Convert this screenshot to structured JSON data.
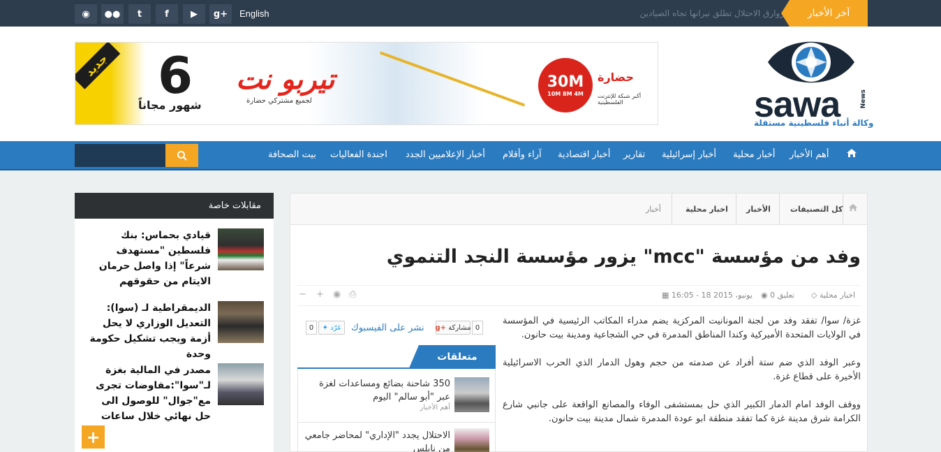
{
  "topbar": {
    "social": [
      {
        "icon": "rss-icon",
        "glyph": "◉"
      },
      {
        "icon": "flickr-icon",
        "glyph": "●●"
      },
      {
        "icon": "twitter-icon",
        "glyph": "t"
      },
      {
        "icon": "facebook-icon",
        "glyph": "f"
      },
      {
        "icon": "youtube-icon",
        "glyph": "▶"
      },
      {
        "icon": "google-plus-icon",
        "glyph": "g+"
      }
    ],
    "language_link": "English",
    "ticker_text": "زوارق الاحتلال تطلق نيرانها تجاه الصيادين",
    "latest_tab": "آخر الأخبار"
  },
  "header": {
    "logo_text": "sawa",
    "logo_news": "News",
    "logo_tagline": "وكالة أنباء فلسطينية مستقلة",
    "banner": {
      "new_label": "جديد",
      "big_number": "6",
      "months_text": "شهور مجاناً",
      "brand": "تيربو نت",
      "brand_sub": "لجميع مشتركي حضارة",
      "speed": "30M",
      "speed_sub": "10M 8M 4M",
      "isp": "حضارة",
      "isp_sub": "أكبر شبكة للإنترنت الفلسطينية"
    }
  },
  "nav": {
    "search_placeholder": "",
    "items": [
      "أهم الأخبار",
      "أخبار محلية",
      "أخبار إسرائيلية",
      "تقارير",
      "أخبار اقتصادية",
      "آراء وأقلام",
      "أخبار الإعلاميين الجدد",
      "اجندة الفعاليات",
      "بيت الصحافة"
    ]
  },
  "sidebar": {
    "title": "مقابلات خاصة",
    "items": [
      {
        "title": "قيادي بحماس: بنك فلسطين \"مستهدف شرعاً\" إذا واصل حرمان الايتام من حقوقهم"
      },
      {
        "title": "الديمقراطية لـ (سوا): التعديل الوزاري لا يحل أزمة ويجب تشكيل حكومة وحدة"
      },
      {
        "title": "مصدر في المالية بغزة لـ\"سوا\":مفاوضات تجرى مع\"جوال\" للوصول الى حل نهائي خلال ساعات"
      }
    ],
    "more_button": "+"
  },
  "breadcrumb": {
    "items": [
      "كل التصنيفات",
      "الأخبار",
      "اخبار محلية",
      "أخبار"
    ]
  },
  "article": {
    "title": "وفد من مؤسسة \"mcc\" يزور مؤسسة النجد التنموي",
    "category": "اخبار محلية",
    "comments": "0 تعليق",
    "datetime": "16:05 - 18 يونيو، 2015",
    "paragraphs": [
      "غزة/ سوا/ تفقد وفد من لجنة المونانيت المركزية يضم مدراء المكاتب الرئيسية في المؤسسة في الولايات المتحدة الأميركية وكندا المناطق المدمرة في حي الشجاعية ومدينة بيت حانون.",
      "وعبر الوفد الذي ضم ستة أفراد عن صدمته من حجم وهول الدمار الذي الحرب الاسرائيلية الأخيرة على قطاع غزة.",
      "ووقف الوفد امام الدمار الكبير الذي حل بمستشفى الوفاء والمصانع الواقعة على جانبي شارع الكرامة شرق مدينة غزة كما تفقد منطقة ابو عودة المدمرة شمال مدينة بيت حانون."
    ]
  },
  "share": {
    "fb_label": "نشر على الفيسبوك",
    "tweet_label": "غرّد",
    "tweet_count": "0",
    "gplus_label": "مشاركة",
    "gplus_count": "0",
    "fb_count": "0"
  },
  "related": {
    "title": "متعلقات",
    "items": [
      {
        "title": "350 شاحنة بضائع ومساعدات لغزة عبر \"أبو سالم\" اليوم",
        "category": "أهم الأخبار"
      },
      {
        "title": "الاحتلال يجدد \"الإداري\" لمحاضر جامعي من نابلس",
        "category": ""
      }
    ]
  },
  "colors": {
    "accent": "#2b7bc1",
    "orange": "#f5a623",
    "dark": "#2e3d4e"
  }
}
